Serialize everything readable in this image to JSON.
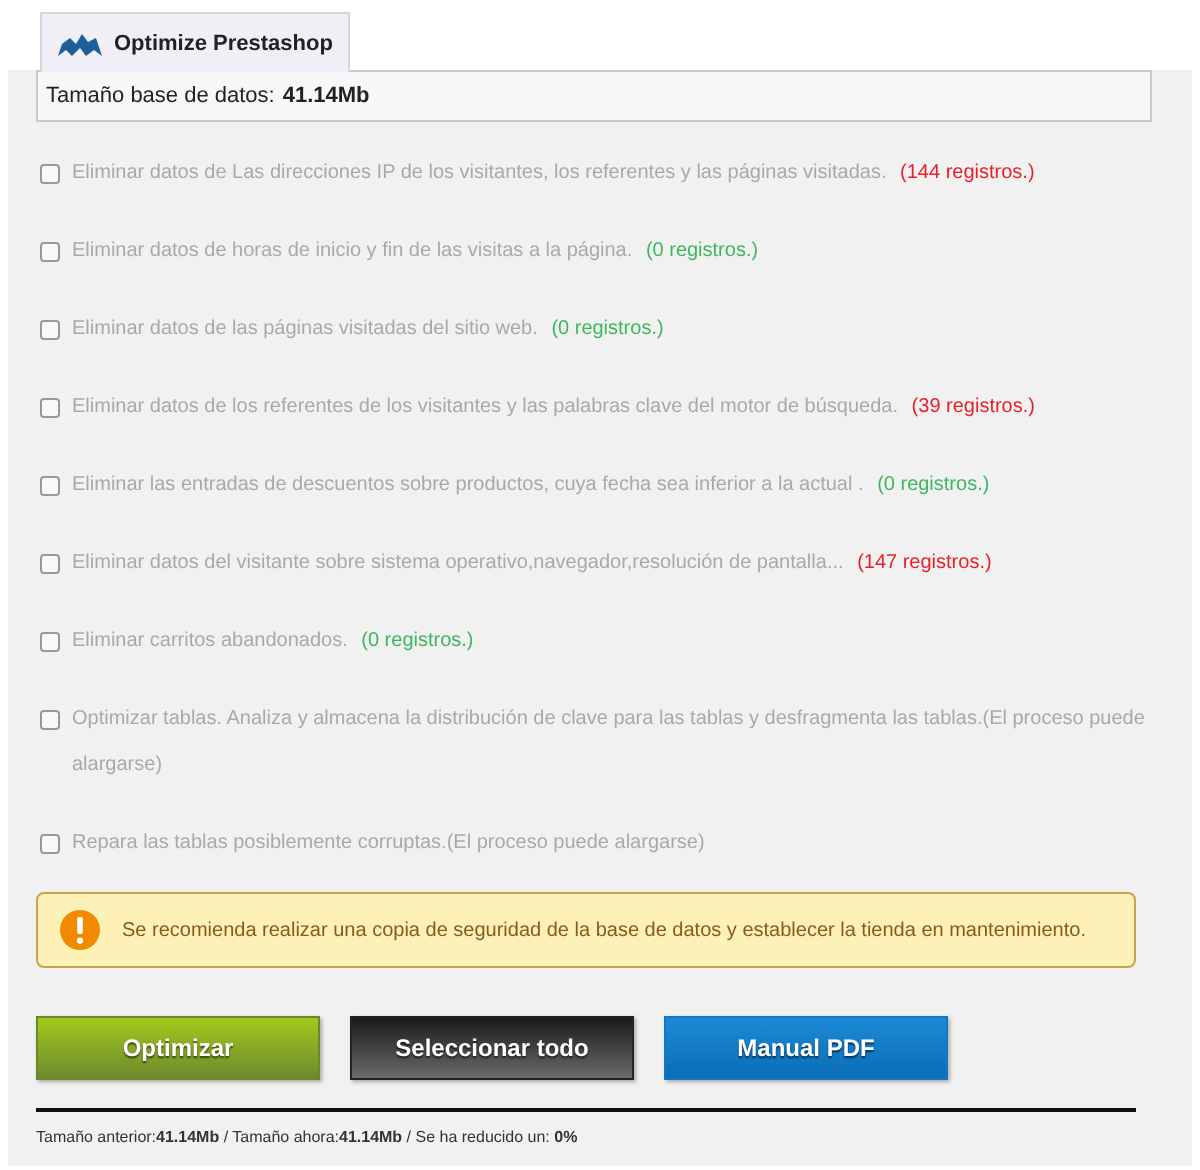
{
  "tab": {
    "label": "Optimize Prestashop",
    "selected": true
  },
  "db_size": {
    "label": "Tamaño base de datos:",
    "value": "41.14Mb"
  },
  "options": [
    {
      "label": "Eliminar datos de Las direcciones IP de los visitantes, los referentes y las páginas visitadas.",
      "count": "(144 registros.)",
      "color": "#e8202a",
      "checked": false
    },
    {
      "label": "Eliminar datos de horas de inicio y fin de las visitas a la página.",
      "count": "(0 registros.)",
      "color": "#3cb85c",
      "checked": false
    },
    {
      "label": "Eliminar datos de las páginas visitadas del sitio web.",
      "count": "(0 registros.)",
      "color": "#3cb85c",
      "checked": false
    },
    {
      "label": "Eliminar datos de los referentes de los visitantes y las palabras clave del motor de búsqueda.",
      "count": "(39 registros.)",
      "color": "#e8202a",
      "checked": false
    },
    {
      "label": "Eliminar las entradas de descuentos sobre productos, cuya fecha sea inferior a la actual .",
      "count": "(0 registros.)",
      "color": "#3cb85c",
      "checked": false
    },
    {
      "label": "Eliminar datos del visitante sobre sistema operativo,navegador,resolución de pantalla...",
      "count": "(147 registros.)",
      "color": "#e8202a",
      "checked": false
    },
    {
      "label": "Eliminar carritos abandonados.",
      "count": "(0 registros.)",
      "color": "#3cb85c",
      "checked": false
    },
    {
      "label": "Optimizar tablas. Analiza y almacena la distribución de clave para las tablas y desfragmenta las tablas.(El proceso puede alargarse)",
      "checked": false
    },
    {
      "label": "Repara las tablas posiblemente corruptas.(El proceso puede alargarse)",
      "checked": false
    }
  ],
  "warning": "Se recomienda realizar una copia de seguridad de la base de datos y establecer la tienda en mantenimiento.",
  "buttons": [
    {
      "label": "Optimizar",
      "kind": "green"
    },
    {
      "label": "Seleccionar todo",
      "kind": "dark"
    },
    {
      "label": "Manual PDF",
      "kind": "blue"
    }
  ],
  "footer": "Tamaño anterior:**41.14Mb** / Tamaño ahora:**41.14Mb** / Se ha reducido un: **0%**"
}
